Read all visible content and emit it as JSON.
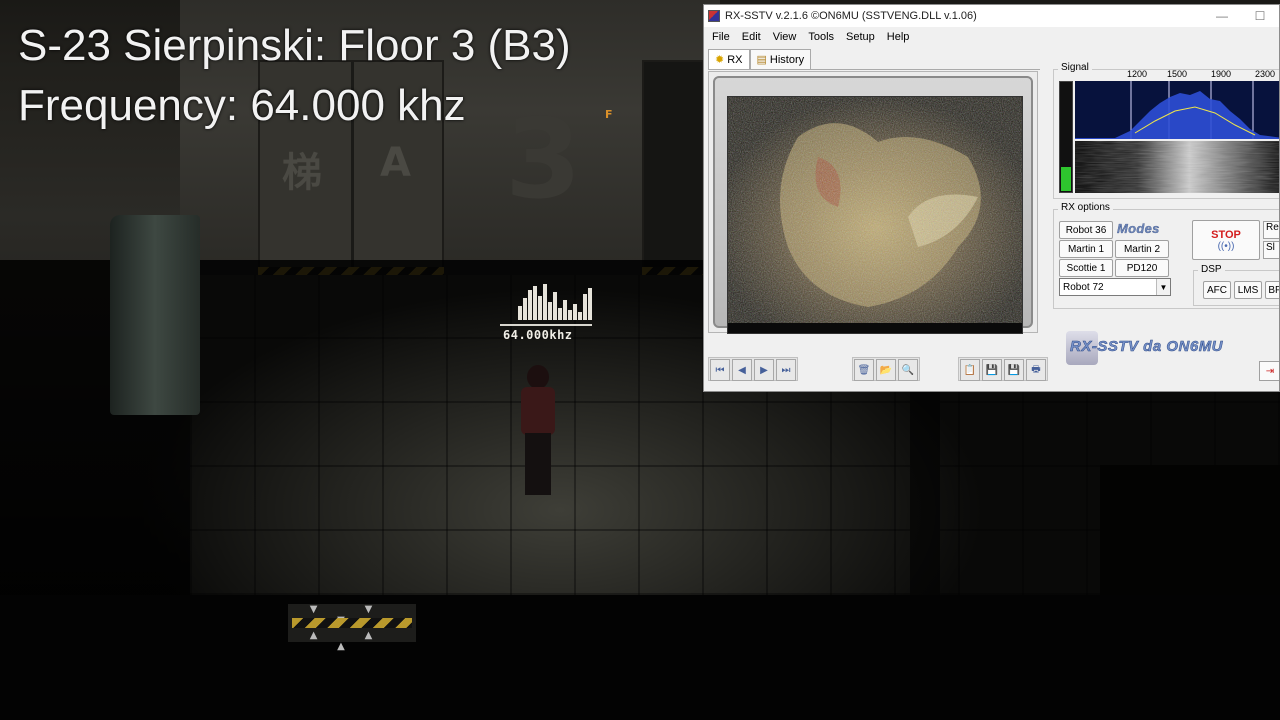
{
  "overlay": {
    "line1": "S-23 Sierpinski: Floor 3 (B3)",
    "line2": "Frequency: 64.000 khz"
  },
  "game": {
    "radio_frequency_text": "64.000khz",
    "door_glyph_1": "梯",
    "door_glyph_2": "A",
    "wall_number": "3",
    "door_sign": "F"
  },
  "window": {
    "title": "RX-SSTV v.2.1.6 ©ON6MU (SSTVENG.DLL v.1.06)",
    "controls": [
      "—",
      "☐"
    ],
    "menu": [
      "File",
      "Edit",
      "View",
      "Tools",
      "Setup",
      "Help"
    ],
    "tabs": [
      {
        "label": "RX",
        "icon": "sun-icon"
      },
      {
        "label": "History",
        "icon": "document-icon"
      }
    ],
    "nav_buttons": [
      "⏮",
      "◀",
      "▶",
      "⏭"
    ],
    "edit_buttons": [
      "🗑",
      "📂",
      "🔍"
    ],
    "file_buttons": [
      "📋",
      "💾",
      "💾",
      "🖶"
    ],
    "signal": {
      "label": "Signal",
      "frequencies": [
        "1200",
        "1500",
        "1900",
        "2300"
      ],
      "level_percent": 22
    },
    "rx_options": {
      "label": "RX options",
      "modes_logo": "Modes",
      "modes": [
        "Robot 36",
        "Martin 1",
        "Martin 2",
        "Scottie 1",
        "PD120"
      ],
      "selected_mode": "Robot 72",
      "stop_label": "STOP",
      "partial_buttons": [
        "Re",
        "Sl"
      ]
    },
    "dsp": {
      "label": "DSP",
      "buttons": [
        "AFC",
        "LMS",
        "BP"
      ]
    },
    "brand": "RX-SSTV da ON6MU",
    "colors": {
      "stop": "#d31d1d",
      "level": "#2ec62e",
      "spectrum_bg": "#07123d"
    }
  }
}
